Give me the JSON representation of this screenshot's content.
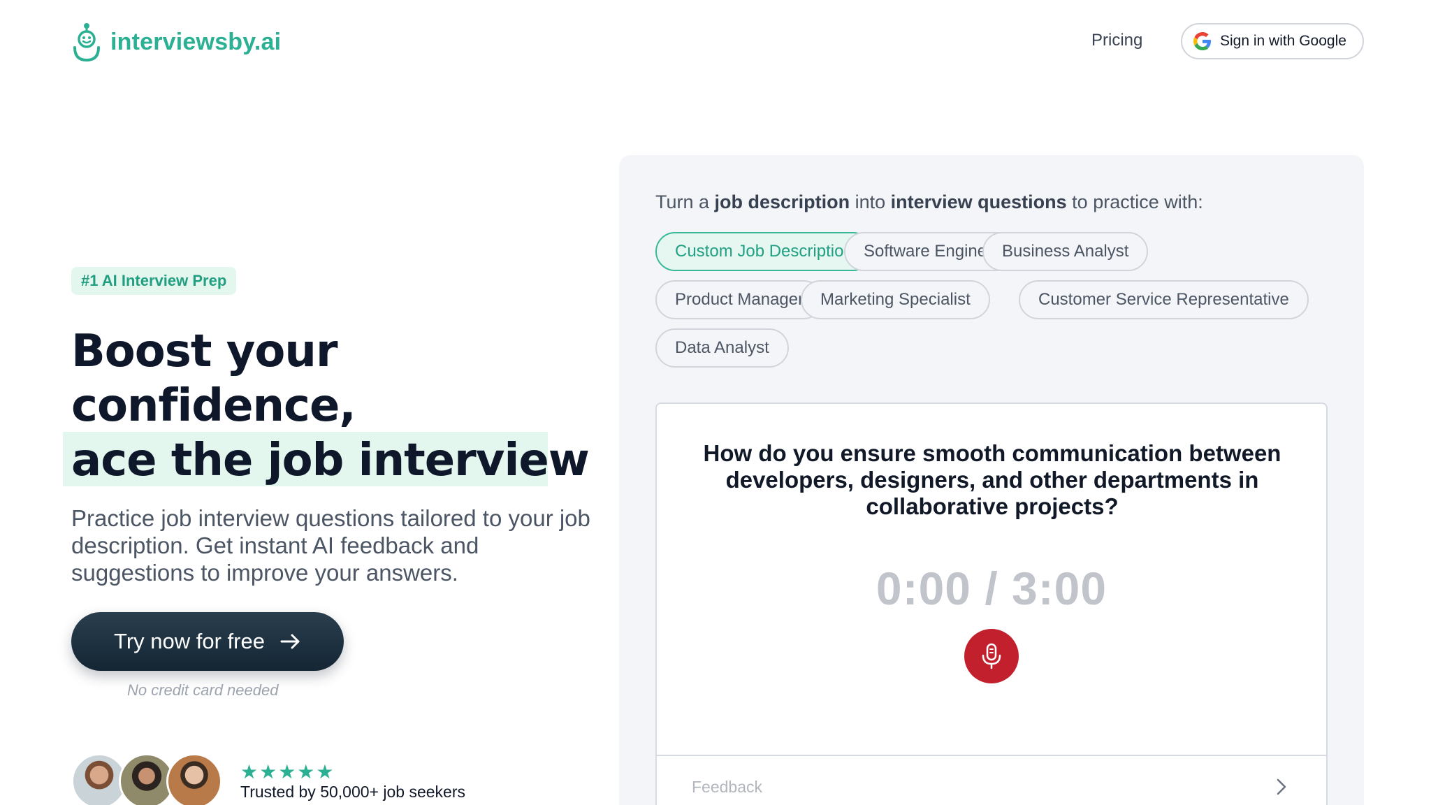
{
  "header": {
    "brand": "interviewsby.ai",
    "nav_pricing": "Pricing",
    "google_signin": "Sign in with Google"
  },
  "hero": {
    "badge": "#1 AI Interview Prep",
    "title_line1": "Boost your",
    "title_line2": "confidence,",
    "title_line3": "ace the job interview",
    "subtitle": "Practice job interview questions tailored to your job description. Get instant AI feedback and suggestions to improve your answers.",
    "cta_label": "Try now for free",
    "cta_note": "No credit card needed",
    "rating_stars": "★★★★★",
    "trusted": "Trusted by 50,000+ job seekers"
  },
  "panel": {
    "intro_p1": "Turn a ",
    "intro_b1": "job description",
    "intro_p2": " into ",
    "intro_b2": "interview questions",
    "intro_p3": " to practice with:",
    "chips": [
      "Custom Job Description",
      "Software Engineer",
      "Business Analyst",
      "Product Manager",
      "Marketing Specialist",
      "Customer Service Representative",
      "Data Analyst"
    ],
    "selected_chip": "Custom Job Description",
    "question": "How do you ensure smooth communication between developers, designers, and other departments in collaborative projects?",
    "timer": "0:00 / 3:00",
    "feedback_label": "Feedback"
  },
  "colors": {
    "brand_green": "#2bb093",
    "cta_dark": "#1b2e3c",
    "mic_red": "#c3202e"
  },
  "icons": {
    "logo": "robot-mascot-icon",
    "google": "google-g-icon",
    "cta_arrow": "arrow-right-icon",
    "mic": "microphone-icon",
    "feedback_chevron": "chevron-right-icon"
  }
}
